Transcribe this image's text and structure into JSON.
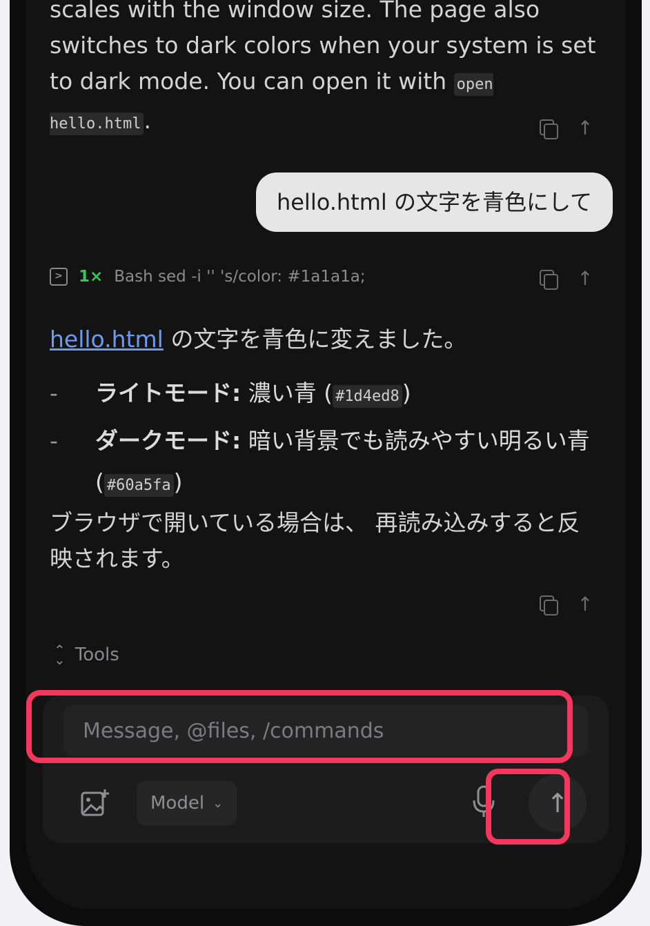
{
  "assistant_prev": {
    "lines": [
      "scales with the window size. The page also",
      "switches to dark colors when your system is set",
      "to dark mode. You can open it with "
    ],
    "code": "open hello.html",
    "tail": "."
  },
  "user_message": "hello.html の文字を青色にして",
  "tool_call": {
    "count": "1×",
    "command": "Bash sed -i '' 's/color: #1a1a1a;"
  },
  "assistant_reply": {
    "link": "hello.html",
    "intro": " の文字を青色に変えました。",
    "bullets": [
      {
        "dash": "-",
        "label": "ライトモード:",
        "text": " 濃い青 (",
        "code": "#1d4ed8",
        "end": ")"
      },
      {
        "dash": "-",
        "label": "ダークモード:",
        "text": " 暗い背景でも読みやすい明るい青 (",
        "code": "#60a5fa",
        "end": ")"
      }
    ],
    "closing": "ブラウザで開いている場合は、 再読み込みすると反映されます。"
  },
  "tools_label": "Tools",
  "composer": {
    "placeholder": "Message, @files, /commands",
    "model_label": "Model"
  },
  "icons": {
    "copy": "copy-icon",
    "share": "arrow-up-icon",
    "terminal": "terminal-icon",
    "image_add": "image-add-icon",
    "mic": "microphone-icon",
    "send": "send-arrow-icon"
  },
  "colors": {
    "highlight": "#f5365d",
    "success_count": "#3cc45c",
    "link": "#6d9bf1"
  }
}
